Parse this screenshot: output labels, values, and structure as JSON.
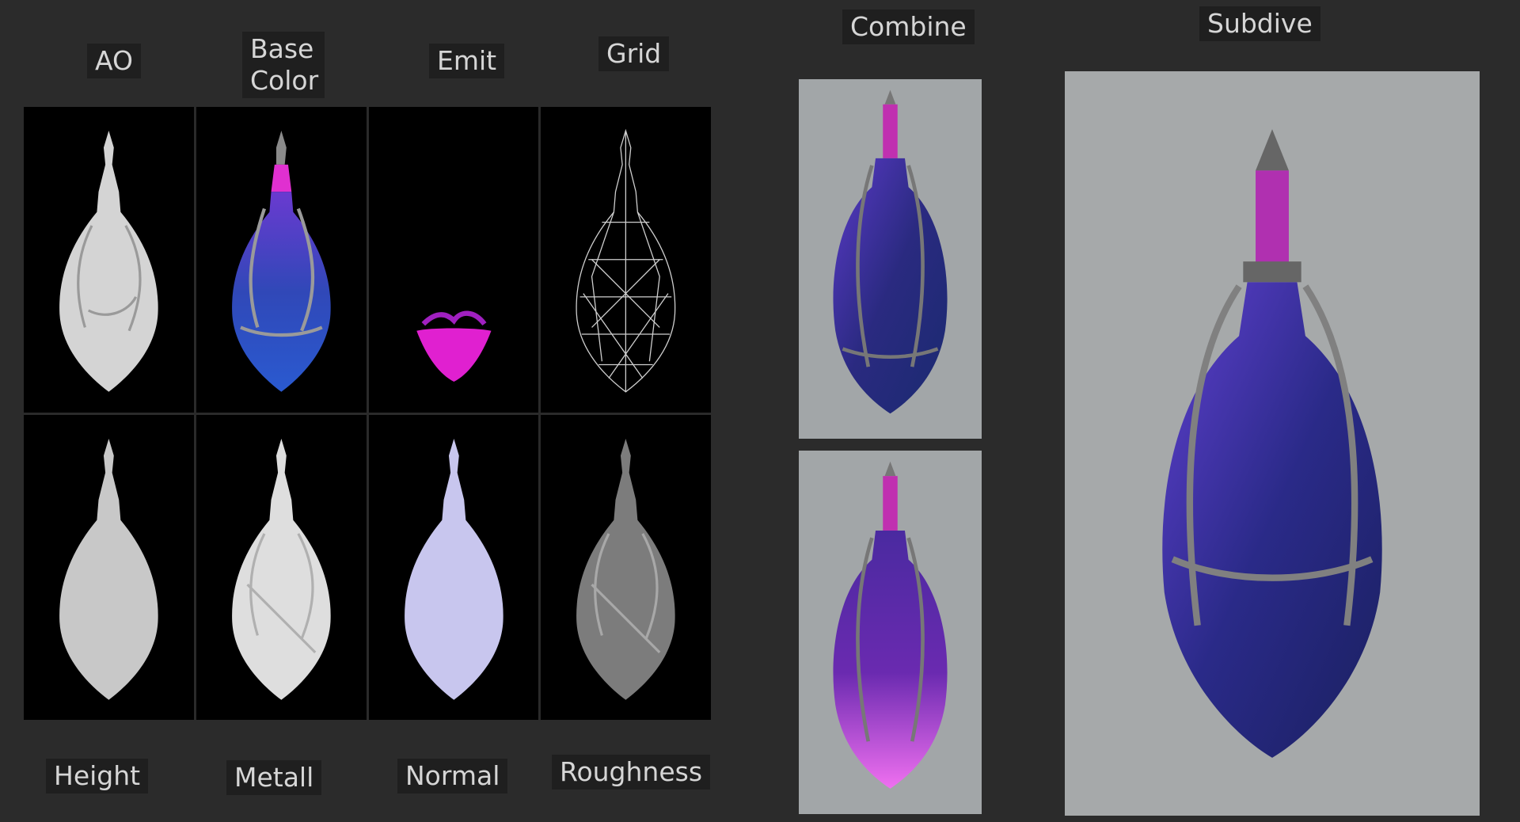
{
  "labels": {
    "ao": "AO",
    "base_color": "Base Color",
    "emit": "Emit",
    "grid": "Grid",
    "height": "Height",
    "metall": "Metall",
    "normal": "Normal",
    "roughness": "Roughness",
    "combine": "Combine",
    "subdive": "Subdive"
  },
  "colors": {
    "background": "#2b2b2b",
    "label_bg": "#1f1f1f",
    "map_bg": "#000000",
    "render_bg": "#a3a6a7",
    "potion_purple": "#3a2a8a",
    "potion_magenta": "#e040e0",
    "metal": "#8a8a8a"
  }
}
